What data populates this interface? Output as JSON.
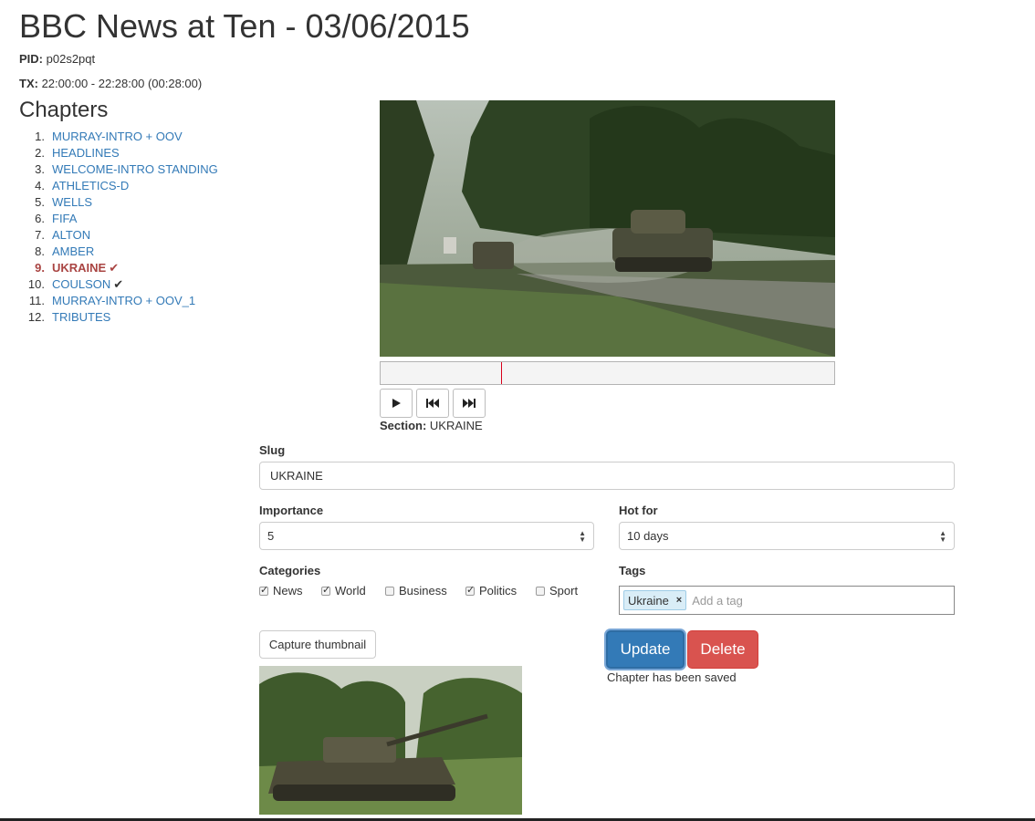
{
  "page": {
    "title": "BBC News at Ten - 03/06/2015"
  },
  "meta": {
    "pid_label": "PID:",
    "pid_value": "p02s2pqt",
    "tx_label": "TX:",
    "tx_value": "22:00:00 - 22:28:00 (00:28:00)"
  },
  "chapters": {
    "heading": "Chapters",
    "items": [
      {
        "num": "1.",
        "label": "MURRAY-INTRO + OOV"
      },
      {
        "num": "2.",
        "label": "HEADLINES"
      },
      {
        "num": "3.",
        "label": "WELCOME-INTRO STANDING"
      },
      {
        "num": "4.",
        "label": "ATHLETICS-D"
      },
      {
        "num": "5.",
        "label": "WELLS"
      },
      {
        "num": "6.",
        "label": "FIFA"
      },
      {
        "num": "7.",
        "label": "ALTON"
      },
      {
        "num": "8.",
        "label": "AMBER"
      },
      {
        "num": "9.",
        "label": "UKRAINE"
      },
      {
        "num": "10.",
        "label": "COULSON"
      },
      {
        "num": "11.",
        "label": "MURRAY-INTRO + OOV_1"
      },
      {
        "num": "12.",
        "label": "TRIBUTES"
      }
    ],
    "active_index": 8,
    "active_color": "#a94442",
    "link_color": "#337ab7"
  },
  "player": {
    "playhead_fraction": 0.265,
    "section_label": "Section:",
    "section_value": "UKRAINE",
    "controls": [
      "play-icon",
      "skip-back-icon",
      "skip-forward-icon"
    ]
  },
  "form": {
    "slug_label": "Slug",
    "slug_value": "UKRAINE",
    "importance_label": "Importance",
    "importance_value": "5",
    "hot_for_label": "Hot for",
    "hot_for_value": "10 days",
    "categories_label": "Categories",
    "categories": [
      {
        "label": "News",
        "checked": true
      },
      {
        "label": "World",
        "checked": true
      },
      {
        "label": "Business",
        "checked": false
      },
      {
        "label": "Politics",
        "checked": true
      },
      {
        "label": "Sport",
        "checked": false
      }
    ],
    "tags_label": "Tags",
    "tags": [
      "Ukraine"
    ],
    "tag_remove": "×",
    "tag_placeholder": "Add a tag"
  },
  "actions": {
    "capture_label": "Capture thumbnail",
    "update_label": "Update",
    "delete_label": "Delete",
    "saved_message": "Chapter has been saved",
    "update_color": "#337ab7",
    "delete_color": "#d9534f"
  }
}
